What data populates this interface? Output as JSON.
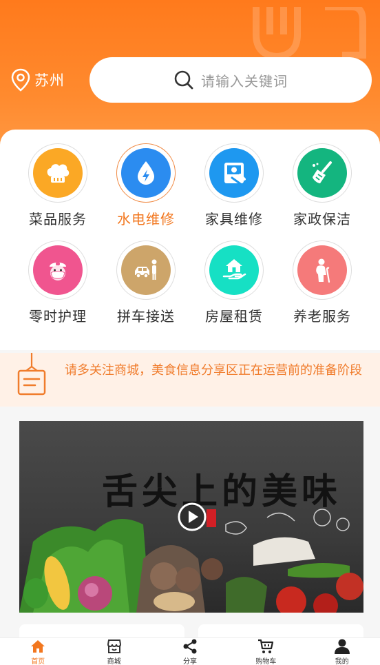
{
  "header": {
    "location": "苏州",
    "search_placeholder": "请输入关键词"
  },
  "categories": [
    {
      "label": "菜品服务",
      "icon": "chef-hat-icon",
      "color": "#fba825",
      "active": false
    },
    {
      "label": "水电维修",
      "icon": "water-bolt-icon",
      "color": "#2b8cf0",
      "active": true
    },
    {
      "label": "家具维修",
      "icon": "furniture-repair-icon",
      "color": "#1e98f0",
      "active": false
    },
    {
      "label": "家政保洁",
      "icon": "broom-icon",
      "color": "#14b57f",
      "active": false
    },
    {
      "label": "零时护理",
      "icon": "nurse-icon",
      "color": "#f0558f",
      "active": false
    },
    {
      "label": "拼车接送",
      "icon": "car-person-icon",
      "color": "#cda56a",
      "active": false
    },
    {
      "label": "房屋租赁",
      "icon": "house-hand-icon",
      "color": "#16e0c4",
      "active": false
    },
    {
      "label": "养老服务",
      "icon": "elderly-icon",
      "color": "#f57a7a",
      "active": false
    }
  ],
  "notice": {
    "text": "请多关注商城，美食信息分享区正在运营前的准备阶段"
  },
  "banner": {
    "title": "舌尖上的美味"
  },
  "tabbar": [
    {
      "label": "首页",
      "icon": "home-icon",
      "active": true
    },
    {
      "label": "商城",
      "icon": "shop-icon",
      "active": false
    },
    {
      "label": "分享",
      "icon": "share-icon",
      "active": false
    },
    {
      "label": "购物车",
      "icon": "cart-icon",
      "active": false
    },
    {
      "label": "我的",
      "icon": "user-icon",
      "active": false
    }
  ],
  "colors": {
    "accent": "#f2771f",
    "header": "#ff8a2e",
    "notice_bg": "#fff1e7"
  }
}
